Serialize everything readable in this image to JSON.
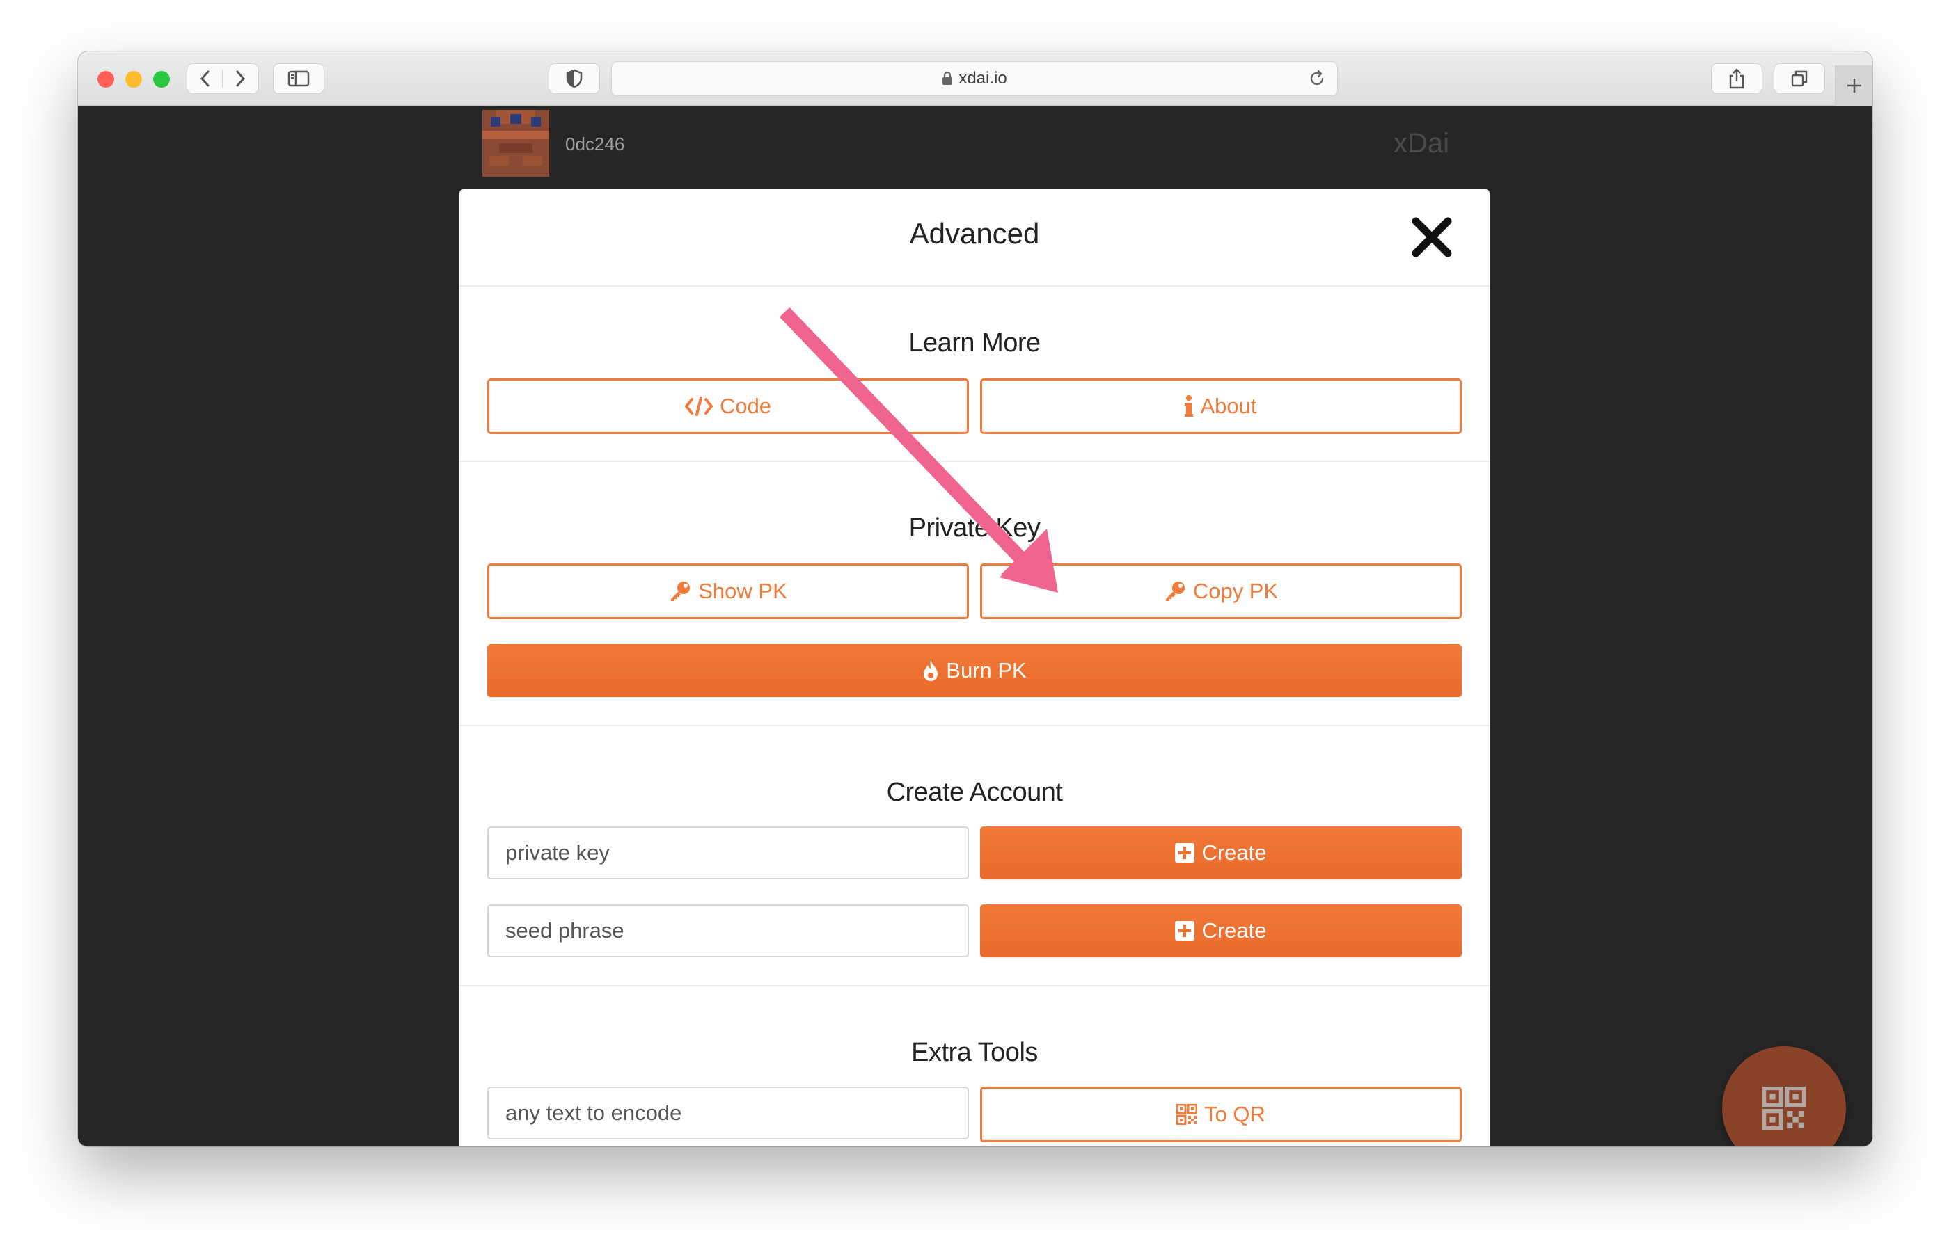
{
  "browser": {
    "url": "xdai.io",
    "traffic_lights": {
      "close": "#ff5f57",
      "minimize": "#febc2e",
      "zoom": "#28c840"
    }
  },
  "header": {
    "address": "0dc246",
    "network": "xDai"
  },
  "modal": {
    "title": "Advanced",
    "learn_more": {
      "title": "Learn More",
      "code_label": "Code",
      "about_label": "About"
    },
    "private_key": {
      "title": "Private Key",
      "show_label": "Show PK",
      "copy_label": "Copy PK",
      "burn_label": "Burn PK"
    },
    "create_account": {
      "title": "Create Account",
      "pk_placeholder": "private key",
      "seed_placeholder": "seed phrase",
      "create_label": "Create"
    },
    "extra_tools": {
      "title": "Extra Tools",
      "text_placeholder": "any text to encode",
      "to_qr_label": "To QR"
    }
  },
  "colors": {
    "accent": "#f07b3a",
    "annotation_arrow": "#f0658f",
    "fab": "#8a4328"
  },
  "icons": {
    "code": "code-icon",
    "about": "info-icon",
    "key": "key-icon",
    "burn": "fire-icon",
    "create": "plus-square-icon",
    "qr": "qrcode-icon",
    "close": "close-icon"
  }
}
